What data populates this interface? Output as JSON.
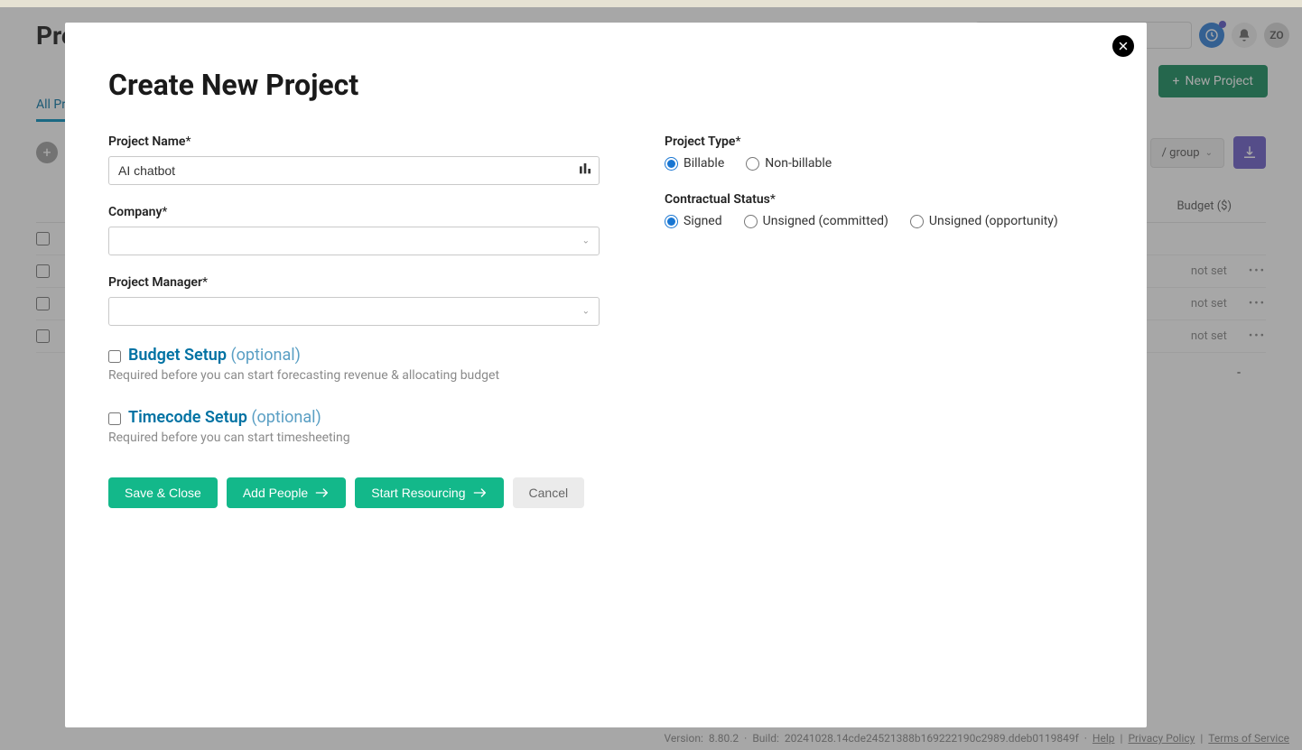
{
  "backdrop": {
    "title": "Projects",
    "tab_all": "All Projects",
    "group_label": "/ group",
    "budget_header": "Budget ($)",
    "not_set": "not set",
    "dash": "-",
    "avatar_initials": "ZO",
    "plus": "+",
    "new_project": "New Project",
    "footer_version_label": "Version:",
    "footer_version": "8.80.2",
    "footer_build_label": "Build:",
    "footer_build": "20241028.14cde24521388b169222190c2989.ddeb0119849f",
    "footer_help": "Help",
    "footer_privacy": "Privacy Policy",
    "footer_terms": "Terms of Service"
  },
  "modal": {
    "title": "Create New Project",
    "project_name_label": "Project Name",
    "project_name_value": "AI chatbot",
    "company_label": "Company",
    "project_manager_label": "Project Manager",
    "project_type_label": "Project Type",
    "type_billable": "Billable",
    "type_nonbillable": "Non-billable",
    "contractual_status_label": "Contractual Status",
    "status_signed": "Signed",
    "status_unsigned_committed": "Unsigned (committed)",
    "status_unsigned_opportunity": "Unsigned (opportunity)",
    "budget_setup_label": "Budget Setup",
    "optional": "(optional)",
    "budget_hint": "Required before you can start forecasting revenue & allocating budget",
    "timecode_setup_label": "Timecode Setup",
    "timecode_hint": "Required before you can start timesheeting",
    "save_close": "Save & Close",
    "add_people": "Add People",
    "start_resourcing": "Start Resourcing",
    "cancel": "Cancel",
    "required_mark": "*"
  }
}
